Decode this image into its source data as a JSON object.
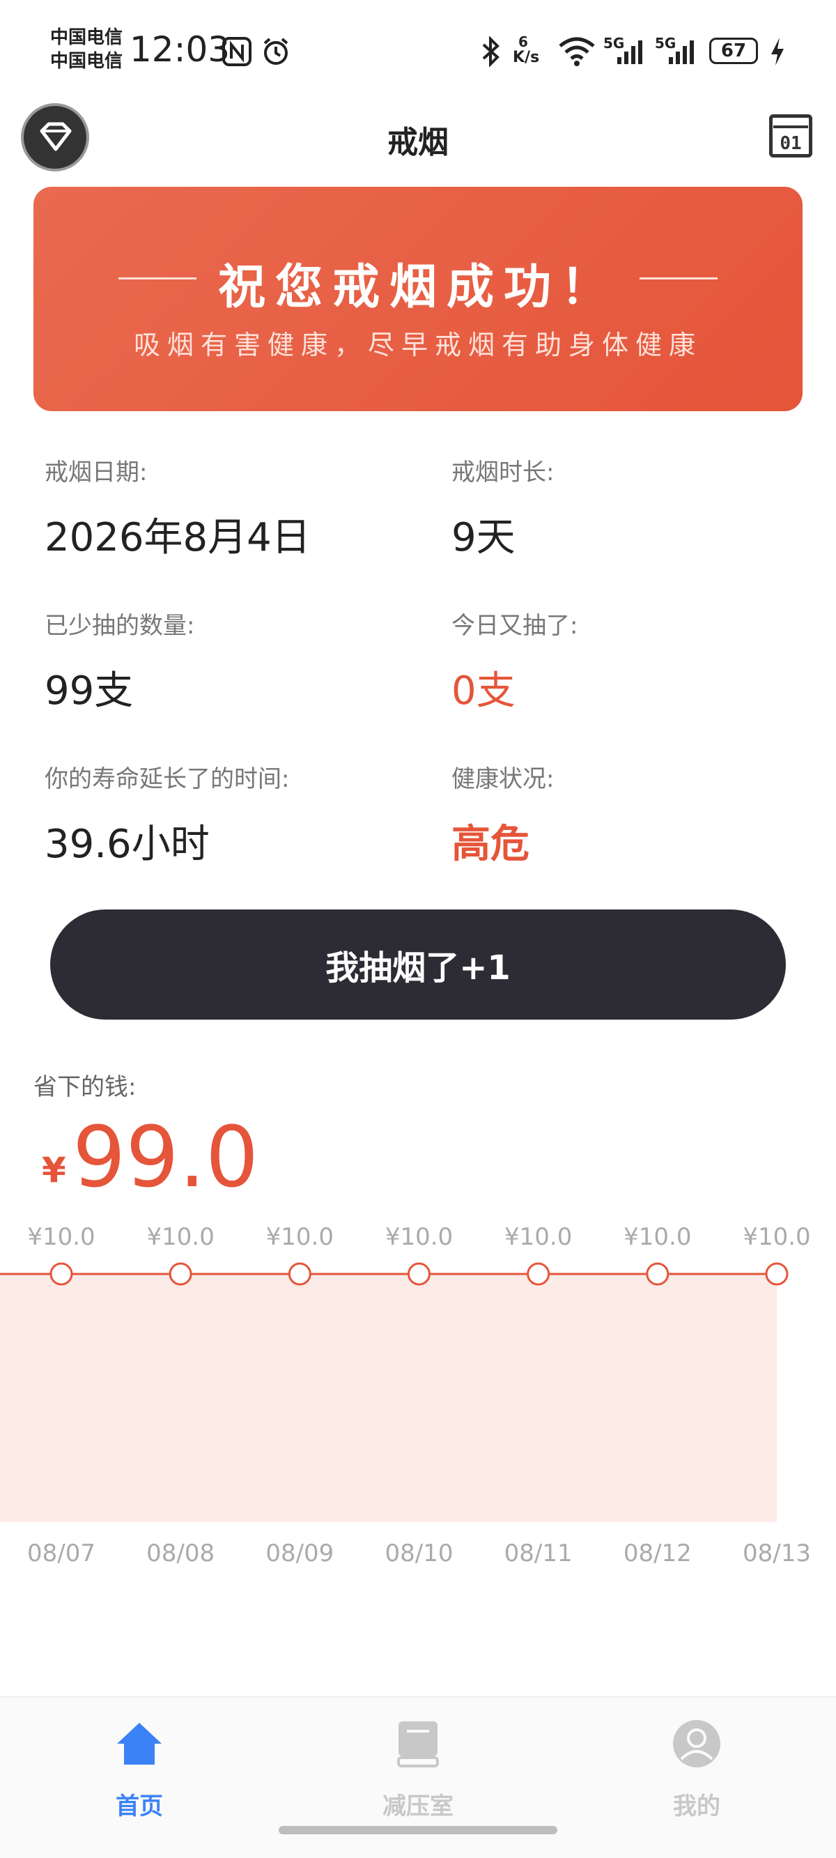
{
  "status_bar": {
    "carrier_1": "中国电信",
    "carrier_2": "中国电信",
    "time": "12:03",
    "net_speed_value": "6",
    "net_speed_unit": "K/s",
    "signal_1": "5G",
    "signal_2": "5G",
    "battery": "67"
  },
  "header": {
    "title": "戒烟"
  },
  "banner": {
    "headline": "祝您戒烟成功！",
    "subtitle": "吸烟有害健康，尽早戒烟有助身体健康"
  },
  "stats": {
    "quit_date_label": "戒烟日期:",
    "quit_date_value": "2026年8月4日",
    "quit_duration_label": "戒烟时长:",
    "quit_duration_value": "9天",
    "reduced_count_label": "已少抽的数量:",
    "reduced_count_value": "99支",
    "today_smoked_label": "今日又抽了:",
    "today_smoked_value": "0支",
    "life_extended_label": "你的寿命延长了的时间:",
    "life_extended_value": "39.6小时",
    "health_label": "健康状况:",
    "health_value": "高危"
  },
  "smoke_button": {
    "label": "我抽烟了+1"
  },
  "savings": {
    "label": "省下的钱:",
    "symbol": "¥",
    "value": "99.0"
  },
  "chart_data": {
    "type": "area",
    "categories": [
      "08/07",
      "08/08",
      "08/09",
      "08/10",
      "08/11",
      "08/12",
      "08/13"
    ],
    "values": [
      10.0,
      10.0,
      10.0,
      10.0,
      10.0,
      10.0,
      10.0
    ],
    "point_labels": [
      "¥10.0",
      "¥10.0",
      "¥10.0",
      "¥10.0",
      "¥10.0",
      "¥10.0",
      "¥10.0"
    ],
    "ylim": [
      0,
      10
    ],
    "grid": false,
    "colors": {
      "line": "#e5553a",
      "fill": "#fcebe7",
      "label": "#aaaaaa"
    }
  },
  "bottom_nav": {
    "items": [
      {
        "label": "首页",
        "icon": "home-icon",
        "active": true
      },
      {
        "label": "减压室",
        "icon": "book-icon",
        "active": false
      },
      {
        "label": "我的",
        "icon": "profile-icon",
        "active": false
      }
    ],
    "active_color": "#3b82f6",
    "inactive_color": "#c8c8c8"
  },
  "colors": {
    "accent": "#e5553a",
    "dark_button": "#2d2c35"
  }
}
